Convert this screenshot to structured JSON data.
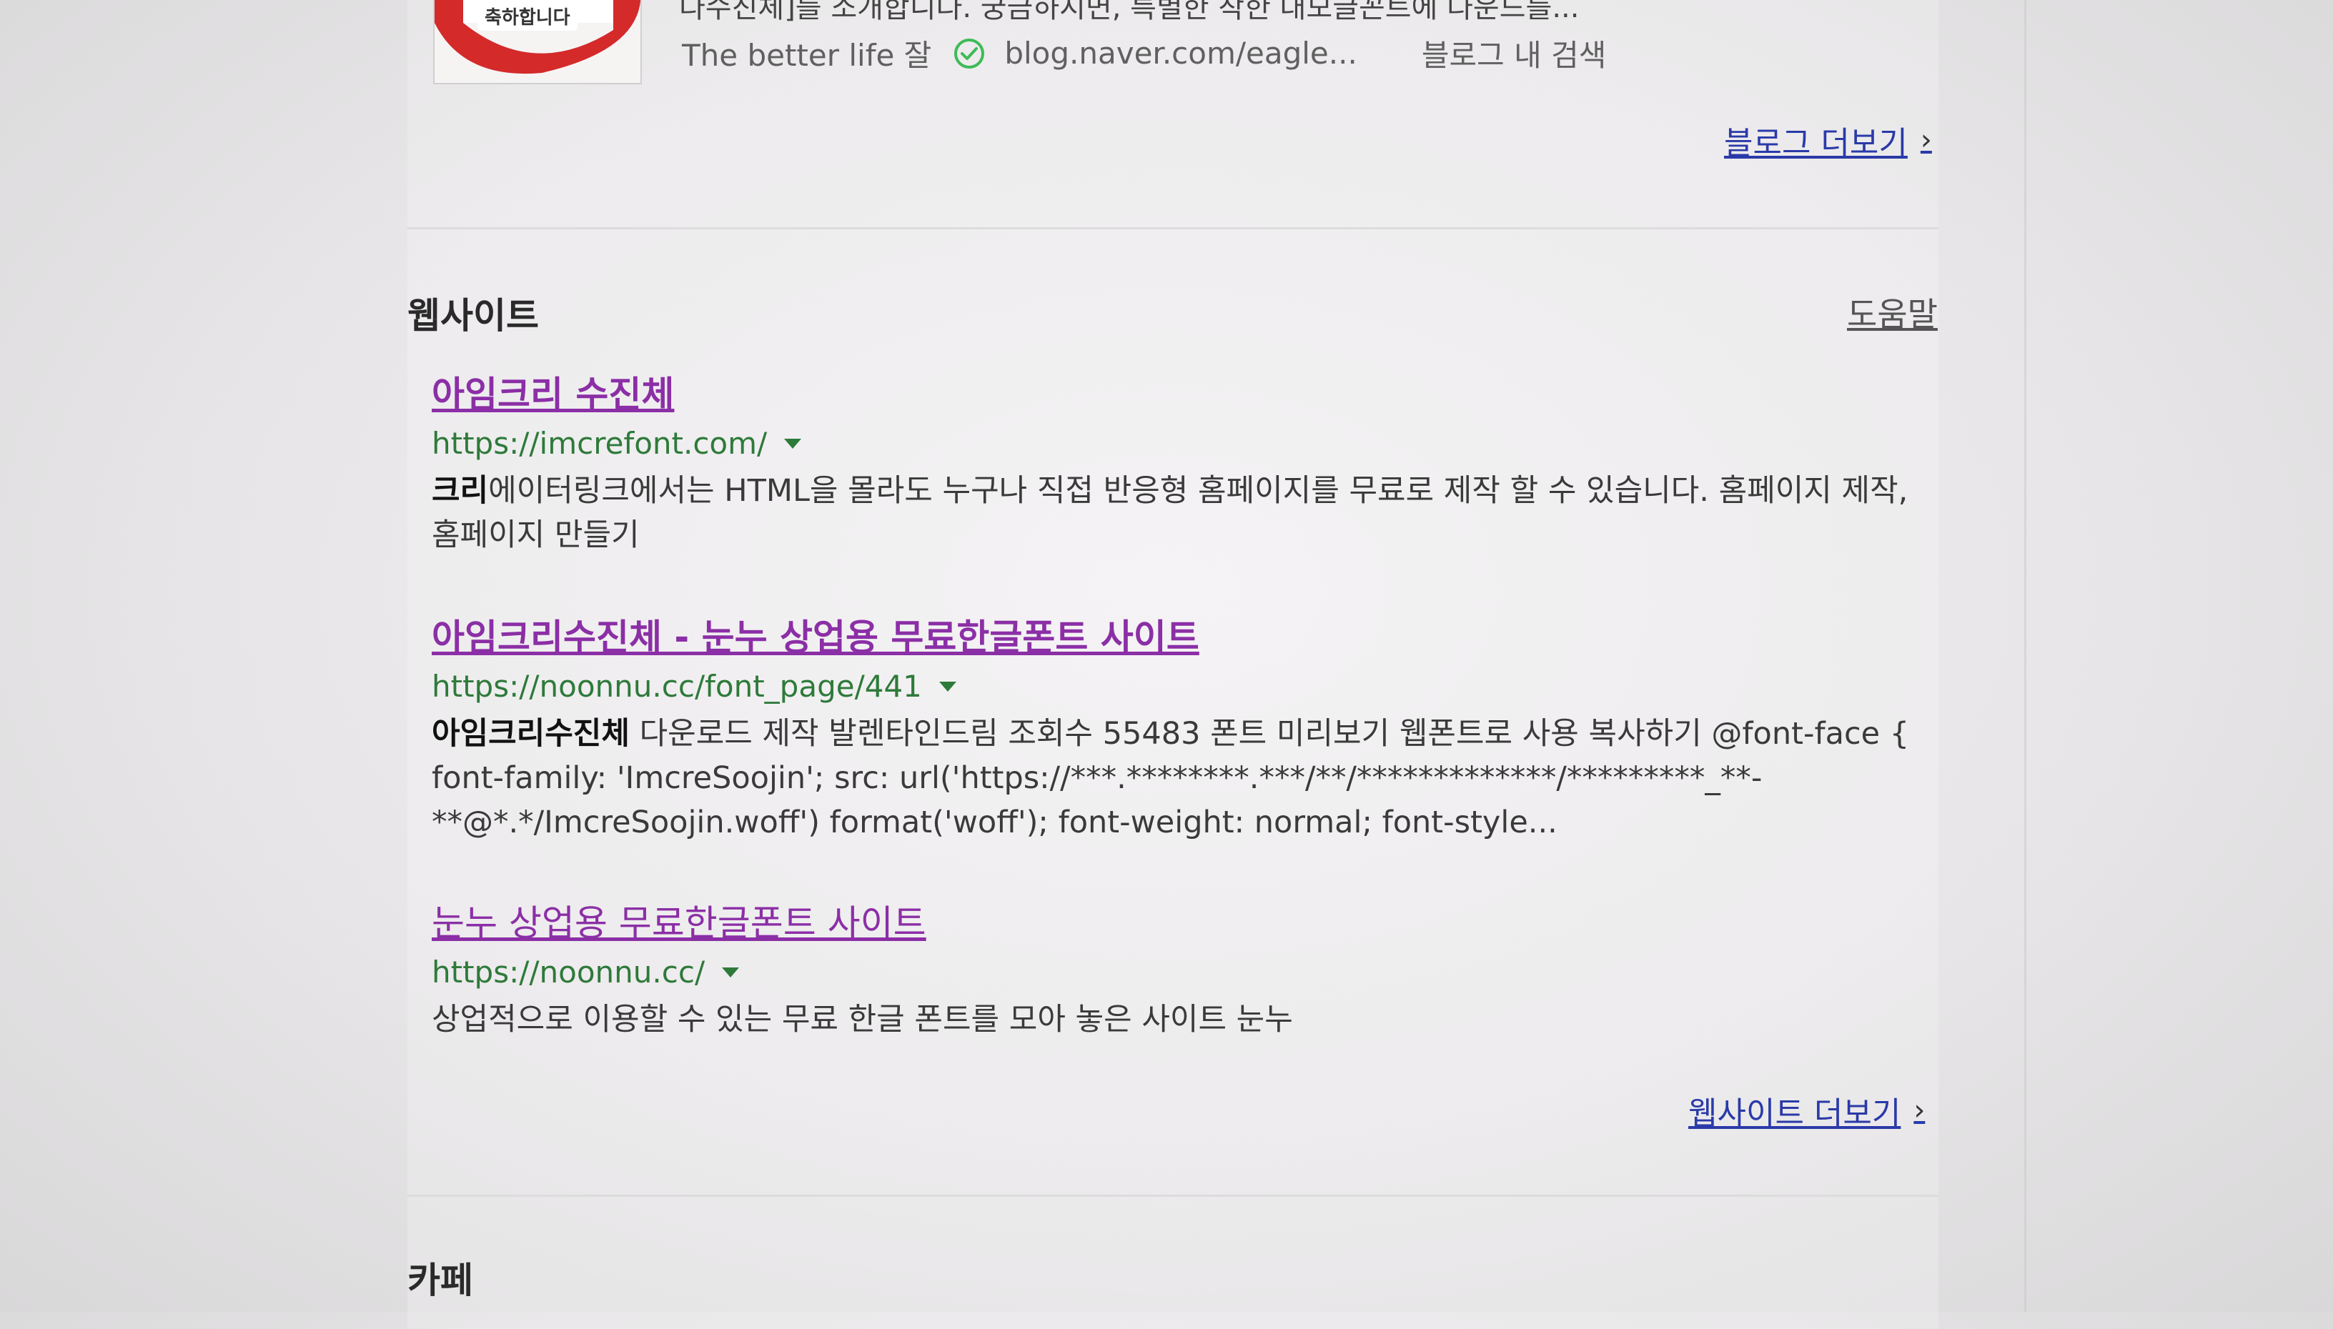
{
  "colors": {
    "visited_title": "#8b2fa6",
    "url_green": "#2e7a3a",
    "more_link_blue": "#2a3aa8",
    "thumbnail_ribbon_red": "#d42a2a"
  },
  "blog": {
    "thumbnail_text": "축하합니다",
    "snippet_partial": "다수진체]를 소개합니다. 궁금하시면, 특별한 착한 대모글꼰트에 다운드를...",
    "blog_name": "The better life 잘",
    "verified_icon": "check-circle-icon",
    "blog_url": "blog.naver.com/eagle...",
    "in_blog_search": "블로그 내 검색",
    "more_label": "블로그 더보기",
    "more_chevron": "›"
  },
  "website": {
    "section_title": "웹사이트",
    "help_label": "도움말",
    "results": [
      {
        "title": "아임크리 수진체",
        "url": "https://imcrefont.com/",
        "desc_highlight": "크리",
        "desc_rest": "에이터링크에서는 HTML을 몰라도 누구나 직접 반응형 홈페이지를 무료로 제작 할 수 있습니다. 홈페이지 제작, 홈페이지 만들기"
      },
      {
        "title": "아임크리수진체 - 눈누 상업용 무료한글폰트 사이트",
        "url": "https://noonnu.cc/font_page/441",
        "desc_highlight": "아임크리수진체",
        "desc_rest": " 다운로드 제작 발렌타인드림 조회수 55483 폰트 미리보기 웹폰트로 사용 복사하기 @font-face { font-family: 'ImcreSoojin'; src: url('https://***.********.***/**/*************/*********_**-**@*.*/ImcreSoojin.woff') format('woff'); font-weight: normal; font-style..."
      },
      {
        "title": "눈누 상업용 무료한글폰트 사이트",
        "url": "https://noonnu.cc/",
        "desc_highlight": "",
        "desc_rest": "상업적으로 이용할 수 있는 무료 한글 폰트를 모아 놓은 사이트 눈누"
      }
    ],
    "more_label": "웹사이트 더보기",
    "more_chevron": "›"
  },
  "cafe": {
    "section_title": "카페"
  }
}
